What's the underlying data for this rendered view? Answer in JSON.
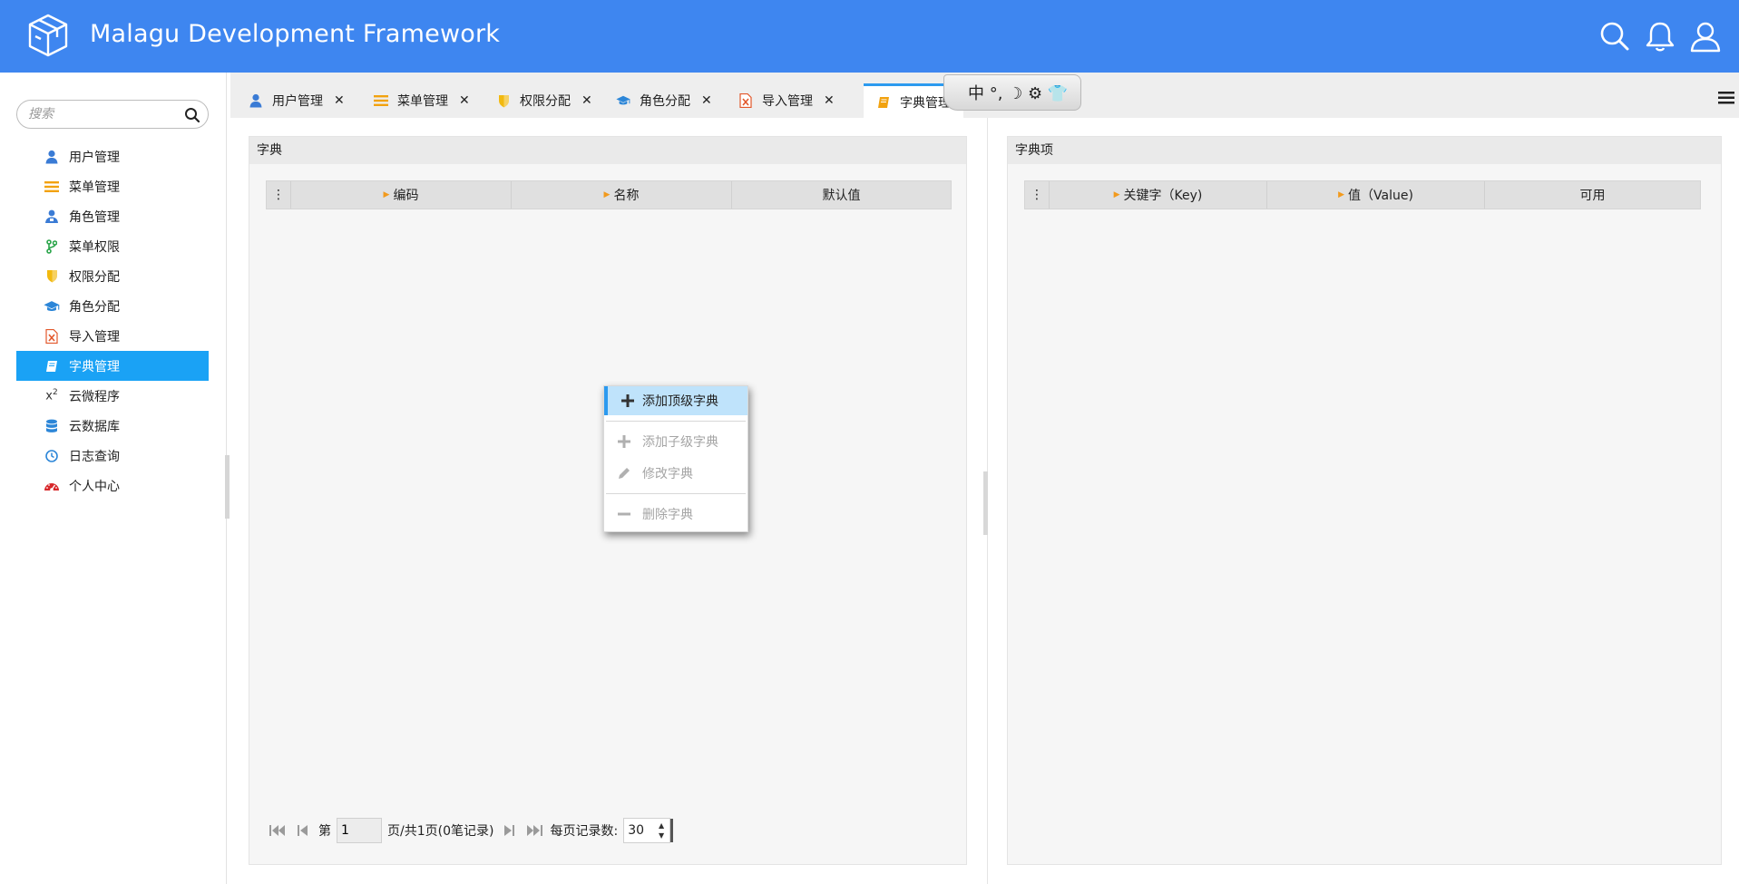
{
  "app": {
    "title": "Malagu Development Framework"
  },
  "header": {
    "icons": [
      "search-icon",
      "bell-icon",
      "user-icon"
    ]
  },
  "sidebar": {
    "search_placeholder": "搜索",
    "items": [
      {
        "label": "用户管理",
        "icon": "user-icon",
        "color": "#3a7bd5"
      },
      {
        "label": "菜单管理",
        "icon": "list-icon",
        "color": "#f2a20f"
      },
      {
        "label": "角色管理",
        "icon": "users-icon",
        "color": "#3a7bd5"
      },
      {
        "label": "菜单权限",
        "icon": "branch-icon",
        "color": "#2aa54a"
      },
      {
        "label": "权限分配",
        "icon": "shield-icon",
        "color": "#f2b90f"
      },
      {
        "label": "角色分配",
        "icon": "graduation-cap-icon",
        "color": "#2c86d8"
      },
      {
        "label": "导入管理",
        "icon": "excel-file-icon",
        "color": "#e2572b"
      },
      {
        "label": "字典管理",
        "icon": "book-icon",
        "color": "#ffffff",
        "active": true
      },
      {
        "label": "云微程序",
        "icon": "superscript-icon",
        "color": "#333333"
      },
      {
        "label": "云数据库",
        "icon": "database-icon",
        "color": "#2c86d8"
      },
      {
        "label": "日志查询",
        "icon": "clock-icon",
        "color": "#2c86d8"
      },
      {
        "label": "个人中心",
        "icon": "dashboard-icon",
        "color": "#d8282b"
      }
    ]
  },
  "tabs": [
    {
      "label": "用户管理",
      "icon": "user-icon",
      "color": "#3a7bd5",
      "close": "✕"
    },
    {
      "label": "菜单管理",
      "icon": "list-icon",
      "color": "#f2a20f",
      "close": "✕"
    },
    {
      "label": "权限分配",
      "icon": "shield-icon",
      "color": "#f2b90f",
      "close": "✕"
    },
    {
      "label": "角色分配",
      "icon": "graduation-cap-icon",
      "color": "#2c86d8",
      "close": "✕"
    },
    {
      "label": "导入管理",
      "icon": "excel-file-icon",
      "color": "#e2572b",
      "close": "✕"
    },
    {
      "label": "字典管理",
      "icon": "book-icon",
      "color": "#f2a20f",
      "active": true
    }
  ],
  "ime_bar": {
    "text": "中 °, ☽ ⚙ 👕"
  },
  "left_panel": {
    "title": "字典",
    "columns": [
      "编码",
      "名称",
      "默认值"
    ],
    "rows": []
  },
  "right_panel": {
    "title": "字典项",
    "columns": [
      "关键字（Key)",
      "值（Value)",
      "可用"
    ],
    "rows": []
  },
  "pager": {
    "page_prefix": "第",
    "page_value": "1",
    "page_suffix": "页/共1页(0笔记录)",
    "size_label": "每页记录数:",
    "size_value": "30"
  },
  "context_menu": {
    "items": [
      {
        "label": "添加顶级字典",
        "icon": "plus-icon",
        "state": "active"
      },
      {
        "label": "添加子级字典",
        "icon": "plus-icon",
        "state": "disabled"
      },
      {
        "label": "修改字典",
        "icon": "pencil-icon",
        "state": "disabled"
      },
      {
        "label": "删除字典",
        "icon": "minus-icon",
        "state": "disabled"
      }
    ]
  }
}
